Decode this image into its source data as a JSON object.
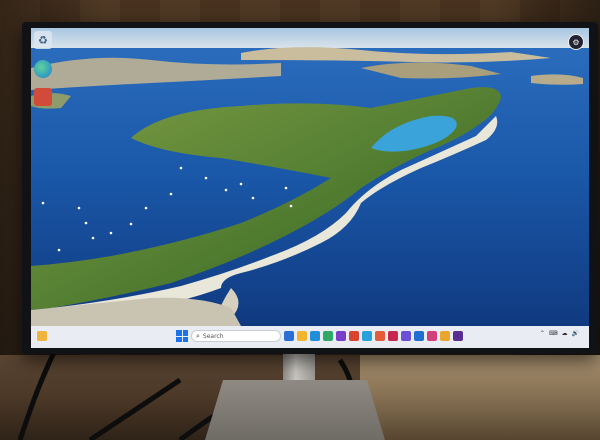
{
  "desktop": {
    "icons": [
      {
        "name": "recycle-bin",
        "glyph": "♻"
      },
      {
        "name": "edge-browser",
        "glyph": ""
      },
      {
        "name": "app-shortcut",
        "glyph": ""
      }
    ]
  },
  "taskbar": {
    "search_placeholder": "Search",
    "search_glyph": "⌕",
    "tray_glyphs": [
      "⌃",
      "⌨",
      "☁",
      "🔊"
    ],
    "app_colors": [
      "#2b6fd6",
      "#f3b52c",
      "#1f8fd8",
      "#2fa866",
      "#7a3fc9",
      "#d8442f",
      "#2aa0d8",
      "#e35d3a",
      "#c9264f",
      "#6b4fd8",
      "#1d6fd1",
      "#d33f7a",
      "#e8a530",
      "#5c2d91"
    ]
  },
  "colors": {
    "sea_deep": "#123f8a",
    "sea_mid": "#1f62b6",
    "lagoon": "#2fa3d6",
    "island_green": "#5f8a3a",
    "cliff": "#e7e3d6",
    "sky": "#b9d3ea"
  }
}
